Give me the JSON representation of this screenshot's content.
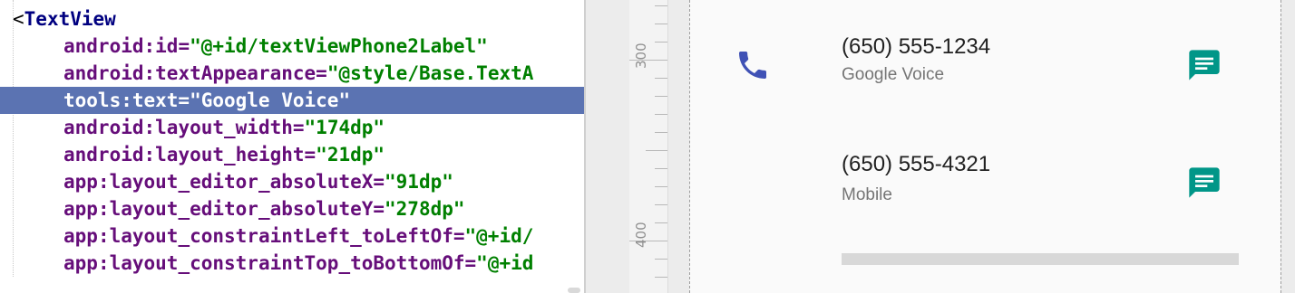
{
  "editor": {
    "lines": [
      {
        "parts": [
          {
            "cls": "c-bracket",
            "text": "<"
          },
          {
            "cls": "c-tag",
            "text": "TextView"
          }
        ]
      },
      {
        "parts": [
          {
            "cls": "c-ns",
            "text": "android"
          },
          {
            "cls": "c-attr",
            "text": ":id="
          },
          {
            "cls": "c-val",
            "text": "\"@+id/textViewPhone2Label\""
          }
        ]
      },
      {
        "parts": [
          {
            "cls": "c-ns",
            "text": "android"
          },
          {
            "cls": "c-attr",
            "text": ":textAppearance="
          },
          {
            "cls": "c-val",
            "text": "\"@style/Base.TextA"
          }
        ]
      },
      {
        "parts": [
          {
            "cls": "c-ns",
            "text": "tools"
          },
          {
            "cls": "c-attr",
            "text": ":text="
          },
          {
            "cls": "c-val",
            "text": "\"Google Voice\""
          }
        ]
      },
      {
        "parts": [
          {
            "cls": "c-ns",
            "text": "android"
          },
          {
            "cls": "c-attr",
            "text": ":layout_width="
          },
          {
            "cls": "c-val",
            "text": "\"174dp\""
          }
        ]
      },
      {
        "parts": [
          {
            "cls": "c-ns",
            "text": "android"
          },
          {
            "cls": "c-attr",
            "text": ":layout_height="
          },
          {
            "cls": "c-val",
            "text": "\"21dp\""
          }
        ]
      },
      {
        "parts": [
          {
            "cls": "c-ns",
            "text": "app"
          },
          {
            "cls": "c-attr",
            "text": ":layout_editor_absoluteX="
          },
          {
            "cls": "c-val",
            "text": "\"91dp\""
          }
        ]
      },
      {
        "parts": [
          {
            "cls": "c-ns",
            "text": "app"
          },
          {
            "cls": "c-attr",
            "text": ":layout_editor_absoluteY="
          },
          {
            "cls": "c-val",
            "text": "\"278dp\""
          }
        ]
      },
      {
        "parts": [
          {
            "cls": "c-ns",
            "text": "app"
          },
          {
            "cls": "c-attr",
            "text": ":layout_constraintLeft_toLeftOf="
          },
          {
            "cls": "c-val",
            "text": "\"@+id/"
          }
        ]
      },
      {
        "parts": [
          {
            "cls": "c-ns",
            "text": "app"
          },
          {
            "cls": "c-attr",
            "text": ":layout_constraintTop_toBottomOf="
          },
          {
            "cls": "c-val",
            "text": "\"@+id"
          }
        ]
      }
    ],
    "selected_line": 3
  },
  "ruler": {
    "label_300": "300",
    "label_400": "400"
  },
  "preview": {
    "phone1_number": "(650) 555-1234",
    "phone1_label": "Google Voice",
    "phone2_number": "(650) 555-4321",
    "phone2_label": "Mobile"
  },
  "icons": {
    "phone": "phone-icon",
    "message": "message-icon"
  },
  "colors": {
    "selection": "#5b73b2",
    "phone_icon": "#3f51b5",
    "message_icon": "#009688",
    "tag": "#000080",
    "attr": "#660e7a",
    "value": "#008000"
  }
}
